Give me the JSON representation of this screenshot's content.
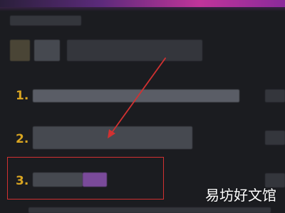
{
  "list": {
    "items": [
      {
        "number": "1."
      },
      {
        "number": "2."
      },
      {
        "number": "3."
      }
    ]
  },
  "watermark": "易坊好文馆",
  "colors": {
    "background": "#1b1c20",
    "number": "#d9a521",
    "annotation": "#d23131"
  }
}
